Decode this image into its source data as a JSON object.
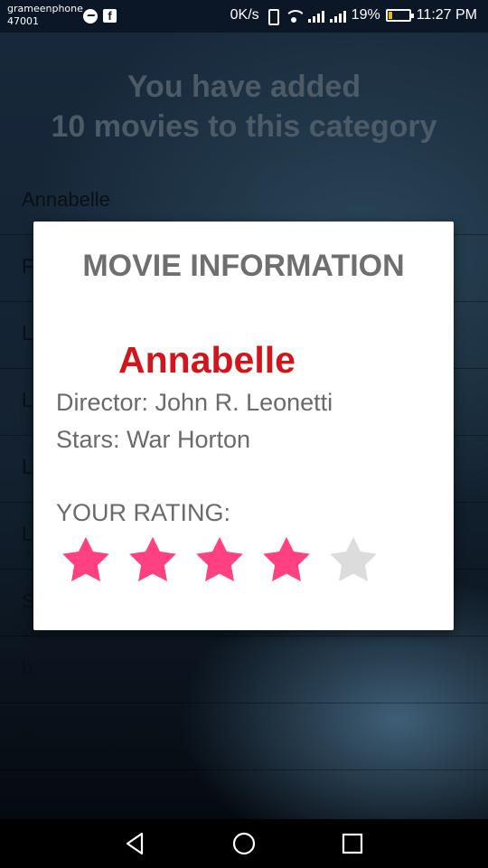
{
  "status_bar": {
    "carrier": "grameenphone",
    "carrier_code": "47001",
    "net_speed": "0K/s",
    "battery_percent": "19%",
    "battery_level": 0.19,
    "time": "11:27 PM",
    "icons": [
      "messenger-icon",
      "facebook-icon",
      "vibrate-icon",
      "wifi-icon",
      "signal-icon",
      "signal-icon",
      "battery-icon"
    ]
  },
  "app": {
    "heading_line1": "You have added",
    "heading_line2": "10 movies to this category",
    "list": [
      "Annabelle",
      "F",
      "L",
      "L",
      "L",
      "L",
      "S",
      "b",
      "d"
    ]
  },
  "dialog": {
    "title": "MOVIE INFORMATION",
    "movie_name": "Annabelle",
    "director_label": "Director: John R. Leonetti",
    "stars_label": "Stars: War Horton",
    "rating_label": "YOUR RATING:",
    "rating": 4,
    "rating_max": 5,
    "star_color_on": "#ff4081",
    "star_color_off": "#dcdcdc"
  },
  "nav_bar": {
    "icons": [
      "back-icon",
      "home-icon",
      "recents-icon"
    ]
  }
}
